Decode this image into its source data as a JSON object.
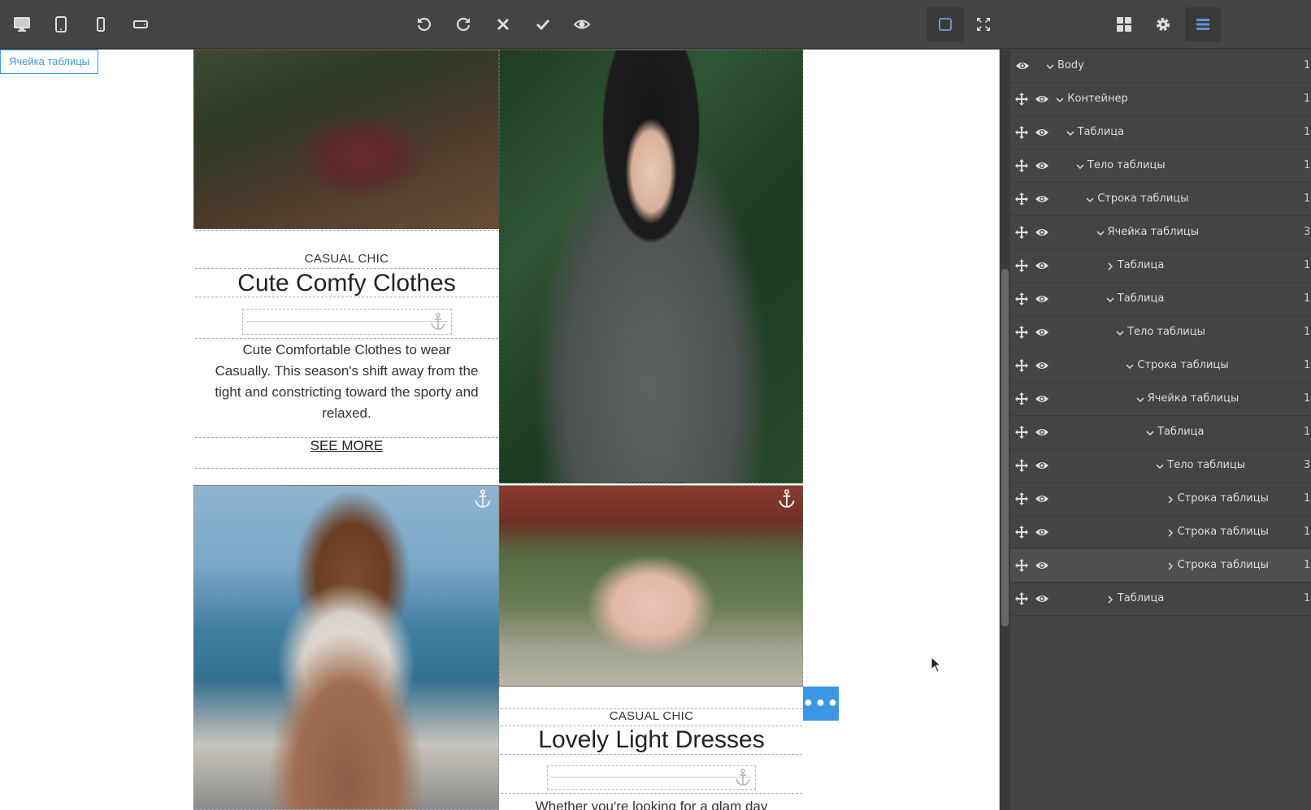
{
  "editor": {
    "selected_badge": "Ячейка таблицы"
  },
  "toolbar": {
    "left": [
      "desktop-icon",
      "tablet-icon",
      "mobile-portrait-icon",
      "mobile-landscape-icon"
    ],
    "center": [
      "undo-icon",
      "redo-icon",
      "close-icon",
      "check-icon",
      "eye-icon"
    ],
    "right": [
      "square-outline-icon",
      "fullscreen-icon"
    ]
  },
  "panel_tabs": [
    "blocks-icon",
    "gear-icon",
    "layers-icon"
  ],
  "content": {
    "card1": {
      "subtitle": "CASUAL CHIC",
      "title": "Cute Comfy Clothes",
      "body": "Cute Comfortable Clothes to wear Casually. This season's shift away from the tight and constricting toward the sporty and relaxed.",
      "link": "SEE MORE"
    },
    "card2": {
      "subtitle": "CASUAL CHIC",
      "title": "Lovely Light Dresses",
      "body": "Whether you're looking for a glam day"
    },
    "more_button": "•••"
  },
  "layers": [
    {
      "name": "Body",
      "count": "1",
      "depth": 0,
      "expanded": true,
      "movable": false
    },
    {
      "name": "Контейнер",
      "count": "1",
      "depth": 1,
      "expanded": true,
      "movable": true
    },
    {
      "name": "Таблица",
      "count": "1",
      "depth": 2,
      "expanded": true,
      "movable": true
    },
    {
      "name": "Тело таблицы",
      "count": "1",
      "depth": 3,
      "expanded": true,
      "movable": true
    },
    {
      "name": "Строка таблицы",
      "count": "1",
      "depth": 4,
      "expanded": true,
      "movable": true
    },
    {
      "name": "Ячейка таблицы",
      "count": "3",
      "depth": 5,
      "expanded": true,
      "movable": true
    },
    {
      "name": "Таблица",
      "count": "1",
      "depth": 6,
      "expanded": false,
      "movable": true
    },
    {
      "name": "Таблица",
      "count": "1",
      "depth": 6,
      "expanded": true,
      "movable": true
    },
    {
      "name": "Тело таблицы",
      "count": "1",
      "depth": 7,
      "expanded": true,
      "movable": true
    },
    {
      "name": "Строка таблицы",
      "count": "1",
      "depth": 8,
      "expanded": true,
      "movable": true
    },
    {
      "name": "Ячейка таблицы",
      "count": "1",
      "depth": 9,
      "expanded": true,
      "movable": true
    },
    {
      "name": "Таблица",
      "count": "1",
      "depth": 10,
      "expanded": true,
      "movable": true
    },
    {
      "name": "Тело таблицы",
      "count": "3",
      "depth": 11,
      "expanded": true,
      "movable": true
    },
    {
      "name": "Строка таблицы",
      "count": "1",
      "depth": 12,
      "expanded": false,
      "movable": true
    },
    {
      "name": "Строка таблицы",
      "count": "1",
      "depth": 12,
      "expanded": false,
      "movable": true
    },
    {
      "name": "Строка таблицы",
      "count": "1",
      "depth": 12,
      "expanded": false,
      "movable": true,
      "hover": true
    },
    {
      "name": "Таблица",
      "count": "1",
      "depth": 6,
      "expanded": false,
      "movable": true
    }
  ],
  "colors": {
    "accent": "#3b97e3",
    "panel_bg": "#444444",
    "active_tab": "#6b8fd8"
  }
}
